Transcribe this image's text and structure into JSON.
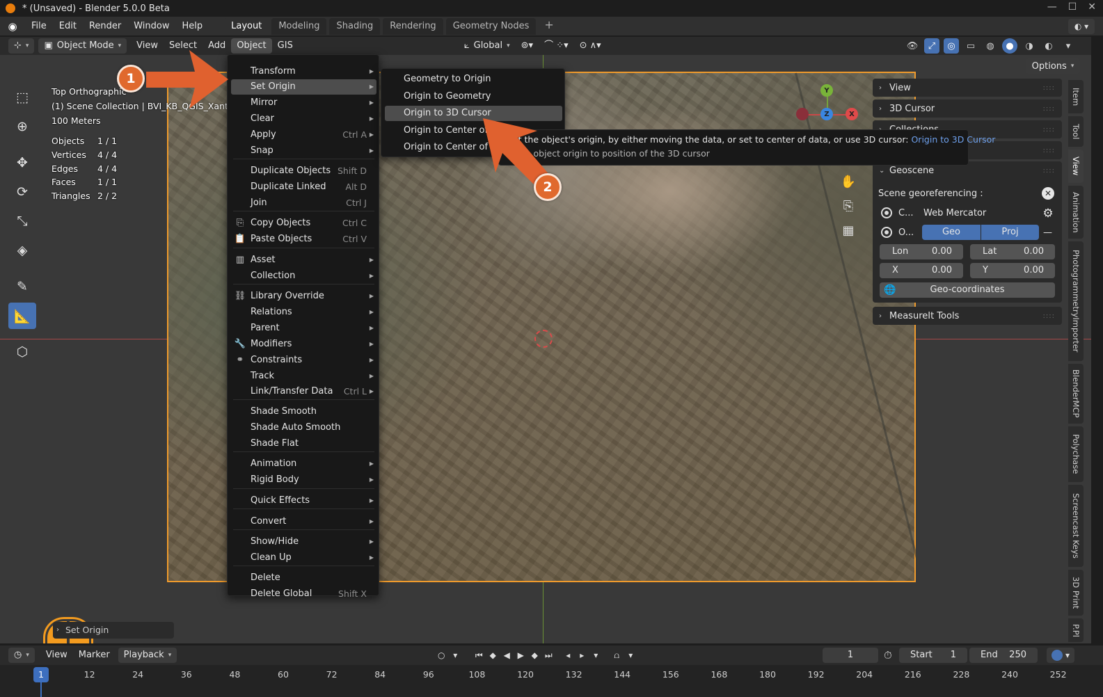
{
  "window": {
    "title": "* (Unsaved) - Blender 5.0.0 Beta"
  },
  "topmenu": {
    "items": [
      "File",
      "Edit",
      "Render",
      "Window",
      "Help"
    ],
    "workspaces": [
      "Layout",
      "Modeling",
      "Shading",
      "Rendering",
      "Geometry Nodes"
    ],
    "add_tab": "+"
  },
  "vp_header": {
    "mode": "Object Mode",
    "menus": [
      "View",
      "Select",
      "Add",
      "Object",
      "GIS"
    ],
    "transform_orientation": "Global",
    "options": "Options"
  },
  "vp_info": {
    "view_name": "Top Orthographic",
    "collection": "(1) Scene Collection | BVI_KB_QGIS_Xanthi",
    "scale": "100 Meters"
  },
  "stats": [
    {
      "k": "Objects",
      "v": "1 / 1"
    },
    {
      "k": "Vertices",
      "v": "4 / 4"
    },
    {
      "k": "Edges",
      "v": "4 / 4"
    },
    {
      "k": "Faces",
      "v": "1 / 1"
    },
    {
      "k": "Triangles",
      "v": "2 / 2"
    }
  ],
  "object_menu": [
    {
      "label": "Transform",
      "shortcut": "",
      "sub": true,
      "icon": ""
    },
    {
      "label": "Set Origin",
      "shortcut": "",
      "sub": true,
      "icon": "",
      "hl": true
    },
    {
      "label": "Mirror",
      "shortcut": "",
      "sub": true,
      "icon": ""
    },
    {
      "label": "Clear",
      "shortcut": "",
      "sub": true,
      "icon": ""
    },
    {
      "label": "Apply",
      "shortcut": "Ctrl A",
      "sub": true,
      "icon": ""
    },
    {
      "label": "Snap",
      "shortcut": "",
      "sub": true,
      "icon": ""
    },
    {
      "label": "Duplicate Objects",
      "shortcut": "Shift D",
      "sub": false,
      "icon": ""
    },
    {
      "label": "Duplicate Linked",
      "shortcut": "Alt D",
      "sub": false,
      "icon": ""
    },
    {
      "label": "Join",
      "shortcut": "Ctrl J",
      "sub": false,
      "icon": ""
    },
    {
      "label": "Copy Objects",
      "shortcut": "Ctrl C",
      "sub": false,
      "icon": "copy-icon"
    },
    {
      "label": "Paste Objects",
      "shortcut": "Ctrl V",
      "sub": false,
      "icon": "paste-icon"
    },
    {
      "label": "Asset",
      "shortcut": "",
      "sub": true,
      "icon": "asset-icon"
    },
    {
      "label": "Collection",
      "shortcut": "",
      "sub": true,
      "icon": ""
    },
    {
      "label": "Library Override",
      "shortcut": "",
      "sub": true,
      "icon": "library-override-icon"
    },
    {
      "label": "Relations",
      "shortcut": "",
      "sub": true,
      "icon": ""
    },
    {
      "label": "Parent",
      "shortcut": "",
      "sub": true,
      "icon": ""
    },
    {
      "label": "Modifiers",
      "shortcut": "",
      "sub": true,
      "icon": "wrench-icon"
    },
    {
      "label": "Constraints",
      "shortcut": "",
      "sub": true,
      "icon": "constraint-icon"
    },
    {
      "label": "Track",
      "shortcut": "",
      "sub": true,
      "icon": ""
    },
    {
      "label": "Link/Transfer Data",
      "shortcut": "Ctrl L",
      "sub": true,
      "icon": ""
    },
    {
      "label": "Shade Smooth",
      "shortcut": "",
      "sub": false,
      "icon": ""
    },
    {
      "label": "Shade Auto Smooth",
      "shortcut": "",
      "sub": false,
      "icon": ""
    },
    {
      "label": "Shade Flat",
      "shortcut": "",
      "sub": false,
      "icon": ""
    },
    {
      "label": "Animation",
      "shortcut": "",
      "sub": true,
      "icon": ""
    },
    {
      "label": "Rigid Body",
      "shortcut": "",
      "sub": true,
      "icon": ""
    },
    {
      "label": "Quick Effects",
      "shortcut": "",
      "sub": true,
      "icon": ""
    },
    {
      "label": "Convert",
      "shortcut": "",
      "sub": true,
      "icon": ""
    },
    {
      "label": "Show/Hide",
      "shortcut": "",
      "sub": true,
      "icon": ""
    },
    {
      "label": "Clean Up",
      "shortcut": "",
      "sub": true,
      "icon": ""
    },
    {
      "label": "Delete",
      "shortcut": "",
      "sub": false,
      "icon": ""
    },
    {
      "label": "Delete Global",
      "shortcut": "Shift X",
      "sub": false,
      "icon": ""
    }
  ],
  "set_origin_menu": [
    "Geometry to Origin",
    "Origin to Geometry",
    "Origin to 3D Cursor",
    "Origin to Center of",
    "Origin to Center of"
  ],
  "tooltip": {
    "line1": "Set the object's origin, by either moving the data, or set to center of data, or use 3D cursor:",
    "line1_py": "Origin to 3D Cursor",
    "line2": "Move object origin to position of the 3D cursor"
  },
  "annotations": [
    "1",
    "2"
  ],
  "npanel": {
    "view": "View",
    "cursor": "3D Cursor",
    "collections": "Collections",
    "geoscene": "Geoscene",
    "georef_label": "Scene georeferencing :",
    "crs_short": "C...",
    "crs_value": "Web Mercator",
    "origin_short": "O...",
    "geo_btn": "Geo",
    "proj_btn": "Proj",
    "minus": "—",
    "lon_label": "Lon",
    "lon_value": "0.00",
    "lat_label": "Lat",
    "lat_value": "0.00",
    "x_label": "X",
    "x_value": "0.00",
    "y_label": "Y",
    "y_value": "0.00",
    "geocoords_btn": "Geo-coordinates",
    "measureit": "MeasureIt Tools"
  },
  "vtabs": [
    "Item",
    "Tool",
    "View",
    "Animation",
    "PhotogrammetryImporter",
    "BlenderMCP",
    "Polychase",
    "Screencast Keys",
    "3D Print",
    "P.Pl"
  ],
  "last_op": "Set Origin",
  "timeline": {
    "menus": [
      "View",
      "Marker"
    ],
    "playback": "Playback",
    "current_frame": "1",
    "start_label": "Start",
    "start_value": "1",
    "end_label": "End",
    "end_value": "250",
    "ticks": [
      "1",
      "12",
      "24",
      "36",
      "48",
      "60",
      "72",
      "84",
      "96",
      "108",
      "120",
      "132",
      "144",
      "156",
      "168",
      "180",
      "192",
      "204",
      "216",
      "228",
      "240",
      "252"
    ]
  },
  "colors": {
    "accent": "#4772b3",
    "selection_outline": "#f09b2c",
    "annotation": "#e0692d"
  }
}
